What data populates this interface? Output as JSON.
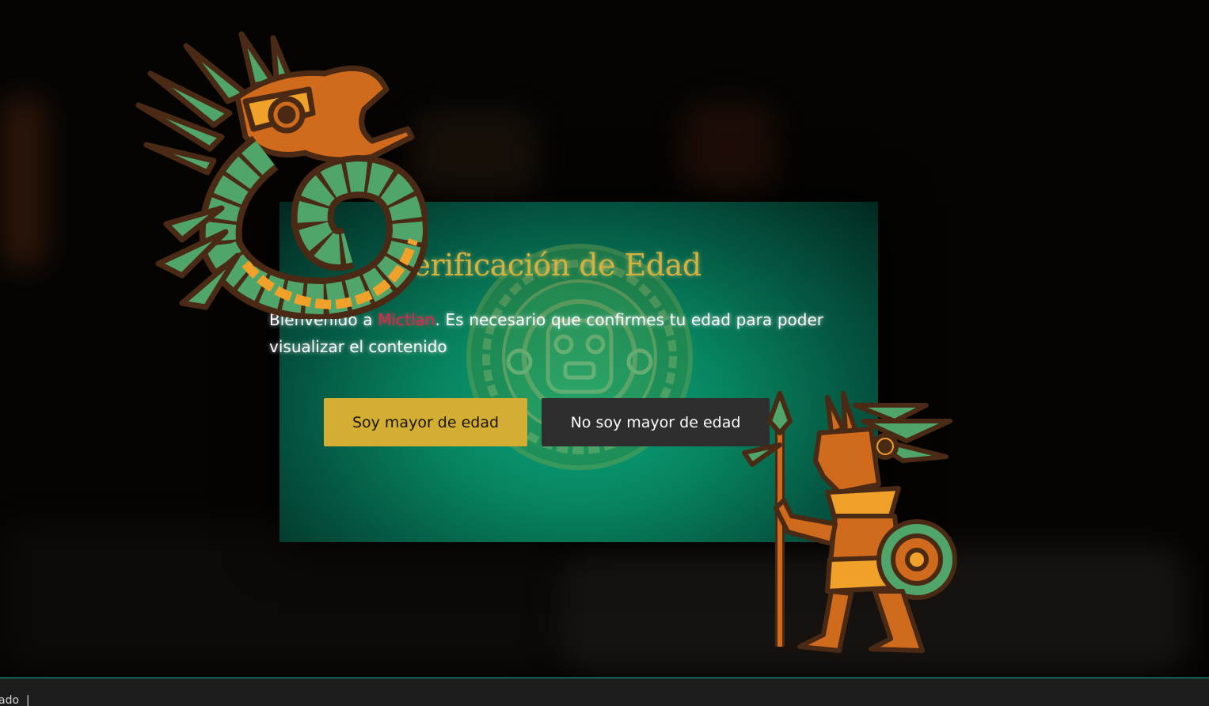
{
  "modal": {
    "title": "Verificación de Edad",
    "message_prefix": "Bienvenido a ",
    "brand": "Mictlan",
    "message_suffix": ". Es necesario que confirmes tu edad para poder visualizar el contenido",
    "confirm_button": "Soy mayor de edad",
    "deny_button": "No soy mayor de edad"
  },
  "statusbar": {
    "text": "ado  |"
  },
  "colors": {
    "title": "#d7b13a",
    "brand": "#e5244a",
    "confirm_bg": "#d4ad33",
    "deny_bg": "#2e2e2e",
    "modal_accent": "#0aa57f",
    "status_border": "#1ab7a3"
  },
  "icons": [
    "quetzalcoatl-serpent-icon",
    "aztec-calendar-icon",
    "aztec-warrior-icon"
  ]
}
